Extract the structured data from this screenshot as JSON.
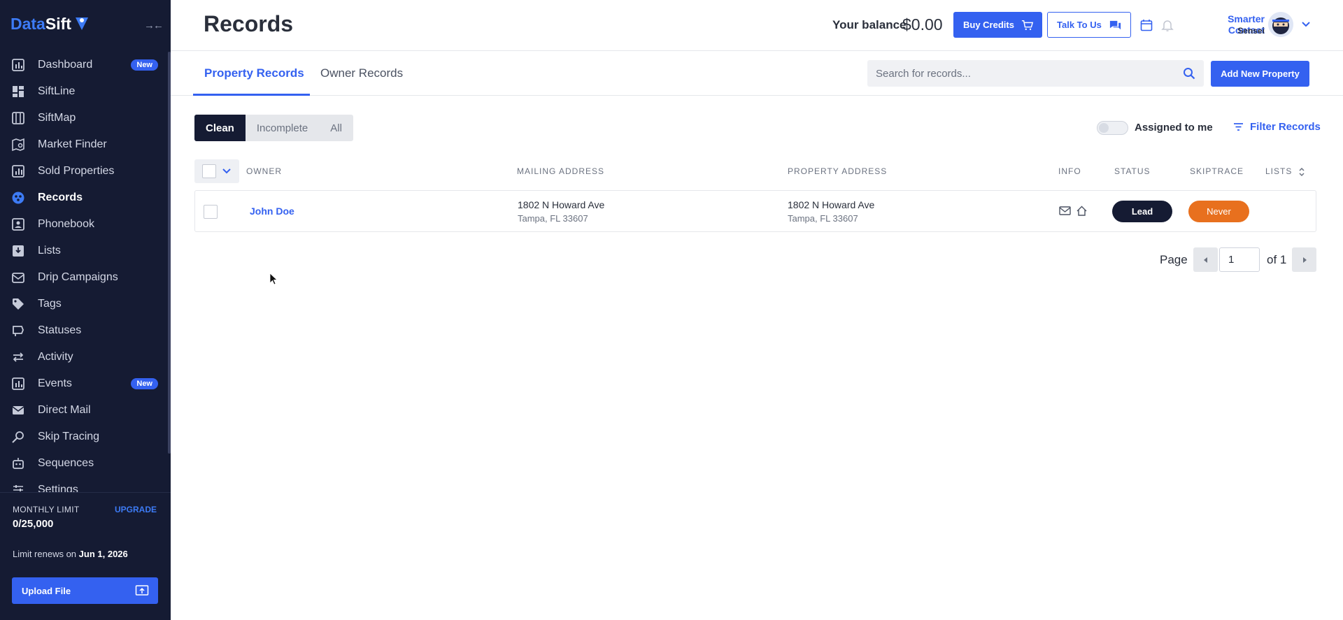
{
  "app": {
    "logo_part1": "Data",
    "logo_part2": "Sift"
  },
  "sidebar": {
    "items": [
      {
        "label": "Dashboard",
        "icon": "bar-chart-icon",
        "badge": "New"
      },
      {
        "label": "SiftLine",
        "icon": "grid-icon"
      },
      {
        "label": "SiftMap",
        "icon": "map-icon"
      },
      {
        "label": "Market Finder",
        "icon": "map-search-icon"
      },
      {
        "label": "Sold Properties",
        "icon": "chart-icon"
      },
      {
        "label": "Records",
        "icon": "records-icon",
        "active": true
      },
      {
        "label": "Phonebook",
        "icon": "phonebook-icon"
      },
      {
        "label": "Lists",
        "icon": "list-download-icon"
      },
      {
        "label": "Drip Campaigns",
        "icon": "mail-stack-icon"
      },
      {
        "label": "Tags",
        "icon": "tag-icon"
      },
      {
        "label": "Statuses",
        "icon": "status-icon"
      },
      {
        "label": "Activity",
        "icon": "arrows-icon"
      },
      {
        "label": "Events",
        "icon": "events-chart-icon",
        "badge": "New"
      },
      {
        "label": "Direct Mail",
        "icon": "mail-icon"
      },
      {
        "label": "Skip Tracing",
        "icon": "magnifier-icon"
      },
      {
        "label": "Sequences",
        "icon": "robot-icon"
      },
      {
        "label": "Settings",
        "icon": "sliders-icon"
      }
    ],
    "monthly_limit_label": "MONTHLY LIMIT",
    "upgrade_label": "UPGRADE",
    "monthly_limit_value": "0/25,000",
    "renews_prefix": "Limit renews on ",
    "renews_date": "Jun 1, 2026",
    "upload_label": "Upload File"
  },
  "header": {
    "title": "Records",
    "balance_label": "Your balance",
    "balance_value": "$0.00",
    "buy_credits": "Buy Credits",
    "talk_to_us": "Talk To Us",
    "user_name": "Smarter Contact",
    "user_sub": "Sensei"
  },
  "tabs": [
    {
      "label": "Property Records",
      "active": true
    },
    {
      "label": "Owner Records",
      "active": false
    }
  ],
  "search": {
    "placeholder": "Search for records..."
  },
  "add_property": "Add New Property",
  "segments": [
    {
      "label": "Clean",
      "active": true
    },
    {
      "label": "Incomplete",
      "active": false
    },
    {
      "label": "All",
      "active": false
    }
  ],
  "assigned_to_me": "Assigned to me",
  "assigned_on": false,
  "filter_records": "Filter Records",
  "table": {
    "columns": [
      "OWNER",
      "MAILING ADDRESS",
      "PROPERTY ADDRESS",
      "INFO",
      "STATUS",
      "SKIPTRACE",
      "LISTS"
    ],
    "rows": [
      {
        "owner": "John Doe",
        "mailing_line1": "1802 N Howard Ave",
        "mailing_line2": "Tampa, FL 33607",
        "property_line1": "1802 N Howard Ave",
        "property_line2": "Tampa, FL 33607",
        "status": "Lead",
        "skiptrace": "Never"
      }
    ]
  },
  "pagination": {
    "page_label": "Page",
    "current": "1",
    "of_label": "of 1"
  },
  "colors": {
    "accent": "#3461f0",
    "sidebar_bg": "#151b33",
    "skiptrace_never": "#e8701e"
  }
}
